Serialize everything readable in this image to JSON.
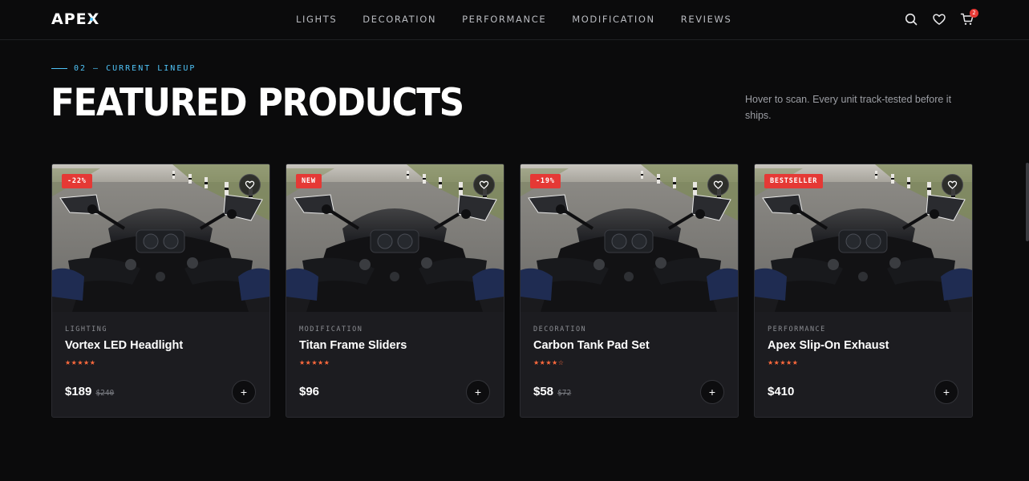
{
  "brand": {
    "name": "APEX",
    "accent": "#4fc3f7"
  },
  "nav": {
    "items": [
      "LIGHTS",
      "DECORATION",
      "PERFORMANCE",
      "MODIFICATION",
      "REVIEWS"
    ]
  },
  "header_icons": {
    "search": "search-icon",
    "wishlist": "heart-icon",
    "cart": "cart-icon",
    "cart_count": "2"
  },
  "section": {
    "eyebrow": "02 — CURRENT LINEUP",
    "title": "FEATURED PRODUCTS",
    "subtitle": "Hover to scan. Every unit track-tested before it ships."
  },
  "colors": {
    "badge": "#e53935",
    "stars": "#ff6a3d",
    "card_bg": "#1c1c20",
    "page_bg": "#0b0b0c"
  },
  "products": [
    {
      "badge": "-22%",
      "category": "LIGHTING",
      "name": "Vortex LED Headlight",
      "rating": 5,
      "stars": "★★★★★",
      "price": "$189",
      "old_price": "$240"
    },
    {
      "badge": "NEW",
      "category": "MODIFICATION",
      "name": "Titan Frame Sliders",
      "rating": 5,
      "stars": "★★★★★",
      "price": "$96",
      "old_price": ""
    },
    {
      "badge": "-19%",
      "category": "DECORATION",
      "name": "Carbon Tank Pad Set",
      "rating": 4,
      "stars": "★★★★☆",
      "price": "$58",
      "old_price": "$72"
    },
    {
      "badge": "BESTSELLER",
      "category": "PERFORMANCE",
      "name": "Apex Slip-On Exhaust",
      "rating": 5,
      "stars": "★★★★★",
      "price": "$410",
      "old_price": ""
    }
  ],
  "add_label": "+"
}
